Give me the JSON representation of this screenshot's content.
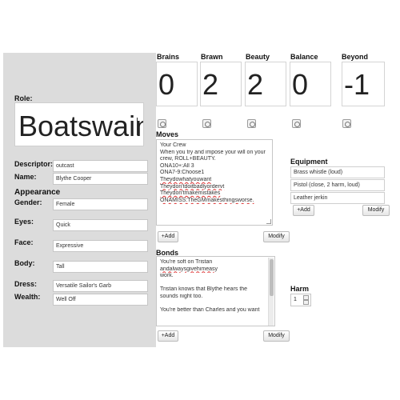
{
  "character": {
    "role_label": "Role:",
    "role": "Boatswain",
    "descriptor_label": "Descriptor:",
    "descriptor": "outcast",
    "name_label": "Name:",
    "name": "Blythe Cooper",
    "appearance_heading": "Appearance",
    "appearance": [
      {
        "label": "Gender:",
        "value": "Female"
      },
      {
        "label": "Eyes:",
        "value": "Quick"
      },
      {
        "label": "Face:",
        "value": "Expressive"
      },
      {
        "label": "Body:",
        "value": "Tall"
      },
      {
        "label": "Dress:",
        "value": "Versatile Sailor's Garb"
      },
      {
        "label": "Wealth:",
        "value": "Well Off"
      }
    ]
  },
  "stats": [
    {
      "label": "Brains",
      "value": "0"
    },
    {
      "label": "Brawn",
      "value": "2"
    },
    {
      "label": "Beauty",
      "value": "2"
    },
    {
      "label": "Balance",
      "value": "0"
    },
    {
      "label": "Beyond",
      "value": "-1"
    }
  ],
  "moves": {
    "heading": "Moves",
    "lines": [
      "Your Crew",
      "When you try and impose your will on your",
      "crew, ROLL+BEAUTY.",
      "ONA10+:All 3",
      "ONA7-9:Choose1",
      "Theydowhatyouwant",
      "Theydon'tdoitbadlyordervt",
      "Theydon'tmakemistakes",
      "ONAMISS:TheGMmakesthingsworse."
    ],
    "add_label": "+Add",
    "modify_label": "Modify"
  },
  "bonds": {
    "heading": "Bonds",
    "lines": [
      "You're soft on Tristan",
      "andalwaysgivehimeasy",
      "work.",
      "",
      "Tristan knows that Blythe hears the",
      "sounds night too.",
      "",
      "You're better than Charles and you want"
    ],
    "add_label": "+Add",
    "modify_label": "Modify"
  },
  "equipment": {
    "heading": "Equipment",
    "items": [
      "Brass whistle (loud)",
      "Pistol (close, 2 harm, loud)",
      "Leather jerkin"
    ],
    "add_label": "+Add",
    "modify_label": "Modify"
  },
  "harm": {
    "heading": "Harm",
    "value": "1"
  }
}
